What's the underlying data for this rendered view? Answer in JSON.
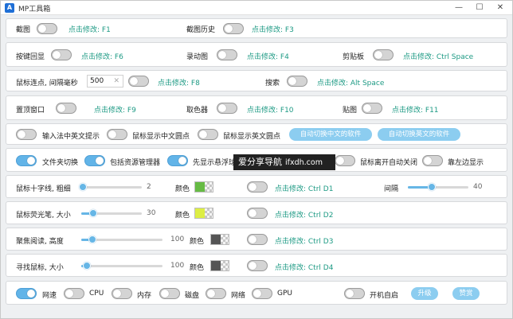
{
  "window": {
    "title": "MP工具箱",
    "minimize": "—",
    "maximize": "☐",
    "close": "✕"
  },
  "row1": {
    "screenshot": "截图",
    "screenshot_hotkey": "点击修改: F1",
    "history": "截图历史",
    "history_hotkey": "点击修改: F3"
  },
  "row2": {
    "keyecho": "按键回显",
    "keyecho_hotkey": "点击修改: F6",
    "record": "录动图",
    "record_hotkey": "点击修改: F4",
    "clipboard": "剪贴板",
    "clipboard_hotkey": "点击修改: Ctrl Space"
  },
  "row3": {
    "autoclick": "鼠标连点, 间隔毫秒",
    "interval_value": "500",
    "clear": "✕",
    "autoclick_hotkey": "点击修改: F8",
    "search": "搜索",
    "search_hotkey": "点击修改: Alt Space"
  },
  "row4": {
    "pin": "置顶窗口",
    "pin_hotkey": "点击修改: F9",
    "picker": "取色器",
    "picker_hotkey": "点击修改: F10",
    "paste": "贴图",
    "paste_hotkey": "点击修改: F11"
  },
  "row5": {
    "ime": "输入法中英文提示",
    "cn_dot": "鼠标显示中文圆点",
    "en_dot": "鼠标显示英文圆点",
    "btn_cn": "自动切换中文的软件",
    "btn_en": "自动切换英文的软件"
  },
  "row6": {
    "folder": "文件夹切换",
    "explorer": "包括资源管理器",
    "hover": "先显示悬浮球",
    "auto_close": "鼠标离开自动关闭",
    "dock": "靠左边显示"
  },
  "crosshair": {
    "label": "鼠标十字线, 粗细",
    "value": "2",
    "color_label": "颜色",
    "hotkey": "点击修改: Ctrl D1",
    "gap_label": "间隔",
    "gap_value": "40",
    "size_level": 0.02,
    "gap_level": 0.4,
    "color": "#66bb44"
  },
  "highlighter": {
    "label": "鼠标荧光笔, 大小",
    "value": "30",
    "color_label": "颜色",
    "hotkey": "点击修改: Ctrl D2",
    "level": 0.2,
    "color": "#ddee44"
  },
  "focus": {
    "label": "聚焦阅读, 高度",
    "value": "100",
    "color_label": "颜色",
    "hotkey": "点击修改: Ctrl D3",
    "level": 0.14,
    "color": "#555555"
  },
  "finder": {
    "label": "寻找鼠标, 大小",
    "value": "100",
    "color_label": "颜色",
    "hotkey": "点击修改: Ctrl D4",
    "level": 0.07,
    "color": "#555555"
  },
  "bottom": {
    "net_speed": "网速",
    "cpu": "CPU",
    "mem": "内存",
    "disk": "磁盘",
    "net": "网络",
    "gpu": "GPU",
    "autostart": "开机自启",
    "upgrade": "升级",
    "donate": "赞赏"
  },
  "watermark": {
    "text": "爱分享导航",
    "domain": "ifxdh.com"
  }
}
